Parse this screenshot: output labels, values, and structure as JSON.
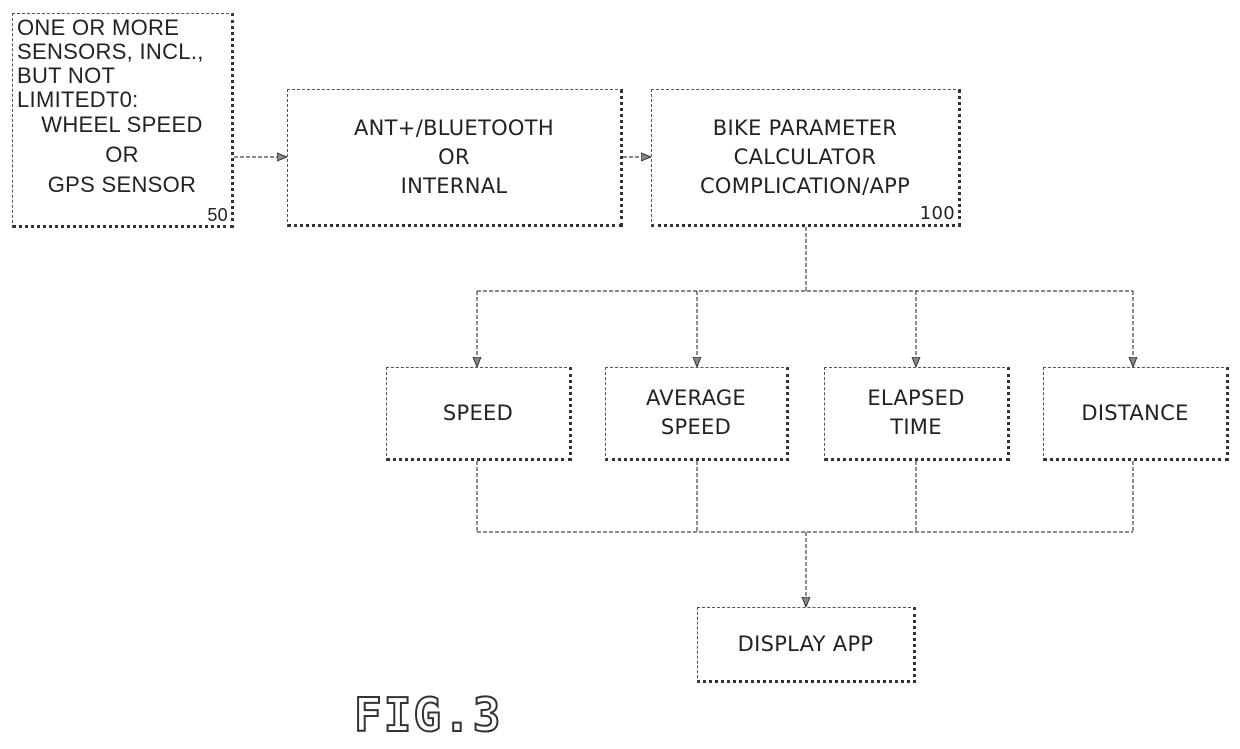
{
  "figure_label": "FIG.3",
  "nodes": {
    "sensors": {
      "header": "ONE OR MORE\nSENSORS, INCL.,\nBUT NOT\nLIMITEDT0:",
      "body": "WHEEL SPEED\nOR\nGPS SENSOR",
      "ref": "50"
    },
    "radio": {
      "label": "ANT+/BLUETOOTH\nOR\nINTERNAL"
    },
    "calculator": {
      "label": "BIKE PARAMETER\nCALCULATOR\nCOMPLICATION/APP",
      "ref": "100"
    },
    "speed": {
      "label": "SPEED"
    },
    "average_speed": {
      "label": "AVERAGE\nSPEED"
    },
    "elapsed_time": {
      "label": "ELAPSED\nTIME"
    },
    "distance": {
      "label": "DISTANCE"
    },
    "display": {
      "label": "DISPLAY APP"
    }
  },
  "edges": [
    {
      "from": "sensors",
      "to": "radio"
    },
    {
      "from": "radio",
      "to": "calculator"
    },
    {
      "from": "calculator",
      "to": "speed"
    },
    {
      "from": "calculator",
      "to": "average_speed"
    },
    {
      "from": "calculator",
      "to": "elapsed_time"
    },
    {
      "from": "calculator",
      "to": "distance"
    },
    {
      "from": "speed",
      "to": "display"
    },
    {
      "from": "average_speed",
      "to": "display"
    },
    {
      "from": "elapsed_time",
      "to": "display"
    },
    {
      "from": "distance",
      "to": "display"
    }
  ]
}
